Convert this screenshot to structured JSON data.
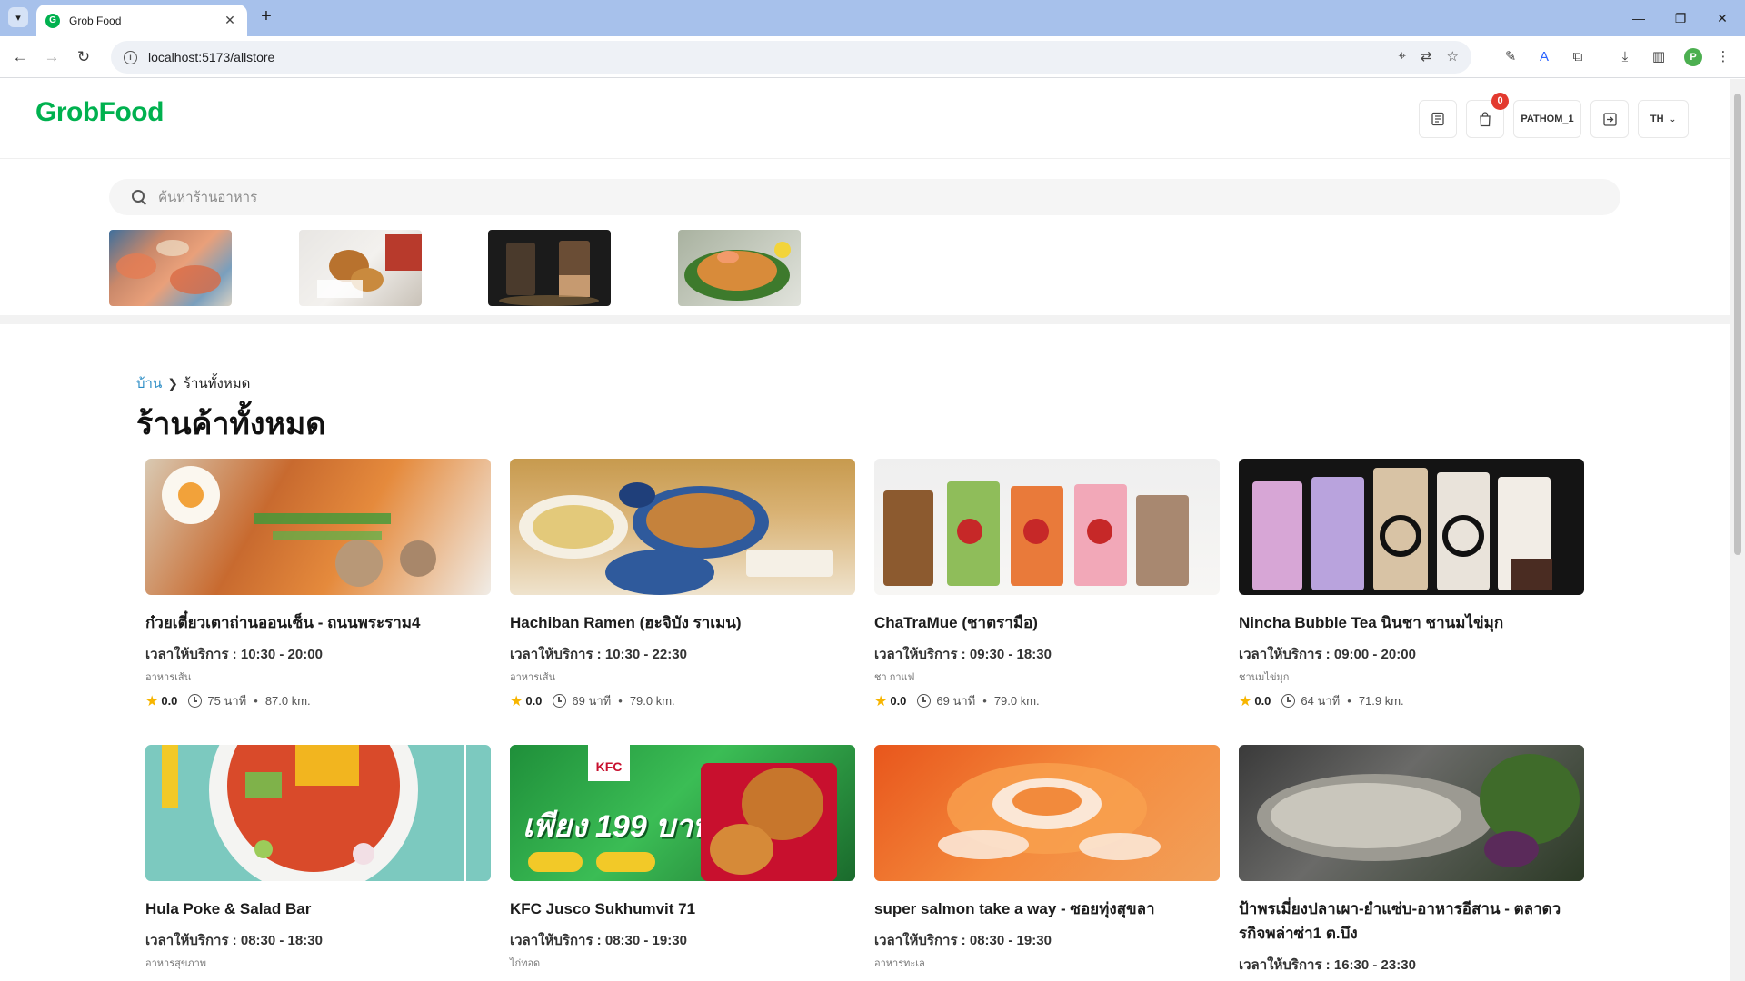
{
  "browser": {
    "tab_title": "Grob Food",
    "url": "localhost:5173/allstore",
    "profile_initial": "P"
  },
  "header": {
    "logo": "GrobFood",
    "cart_count": "0",
    "username": "PATHOM_1",
    "language": "TH"
  },
  "search": {
    "placeholder": "ค้นหาร้านอาหาร"
  },
  "categories": [
    "seafood-image",
    "fried-chicken-image",
    "bubble-tea-image",
    "pad-thai-image"
  ],
  "breadcrumb": {
    "home": "บ้าน",
    "current": "ร้านทั้งหมด"
  },
  "page_title": "ร้านค้าทั้งหมด",
  "stores": [
    {
      "name": "ก๋วยเตี๋ยวเตาถ่านออนเซ็น - ถนนพระราม4",
      "hours": "เวลาให้บริการ : 10:30 - 20:00",
      "category": "อาหารเส้น",
      "rating": "0.0",
      "duration": "75 นาที",
      "distance": "87.0 km."
    },
    {
      "name": "Hachiban Ramen (ฮะจิบัง ราเมน)",
      "hours": "เวลาให้บริการ : 10:30 - 22:30",
      "category": "อาหารเส้น",
      "rating": "0.0",
      "duration": "69 นาที",
      "distance": "79.0 km."
    },
    {
      "name": "ChaTraMue (ชาตรามือ)",
      "hours": "เวลาให้บริการ : 09:30 - 18:30",
      "category": "ชา กาแฟ",
      "rating": "0.0",
      "duration": "69 นาที",
      "distance": "79.0 km."
    },
    {
      "name": "Nincha Bubble Tea นินชา ชานมไข่มุก",
      "hours": "เวลาให้บริการ : 09:00 - 20:00",
      "category": "ชานมไข่มุก",
      "rating": "0.0",
      "duration": "64 นาที",
      "distance": "71.9 km."
    },
    {
      "name": "Hula Poke & Salad Bar",
      "hours": "เวลาให้บริการ : 08:30 - 18:30",
      "category": "อาหารสุขภาพ"
    },
    {
      "name": "KFC Jusco Sukhumvit 71",
      "hours": "เวลาให้บริการ : 08:30 - 19:30",
      "category": "ไก่ทอด"
    },
    {
      "name": "super salmon take a way - ซอยทุ่งสุขลา",
      "hours": "เวลาให้บริการ : 08:30 - 19:30",
      "category": "อาหารทะเล"
    },
    {
      "name": "ป้าพรเมี่ยงปลาเผา-ยำแซ่บ-อาหารอีสาน - ตลาดวรกิจพล่าซ่า1 ต.บึง",
      "hours": "เวลาให้บริการ : 16:30 - 23:30"
    }
  ],
  "kfc_banner": {
    "brand": "KFC",
    "price_text": "เพียง 199 บาท"
  }
}
